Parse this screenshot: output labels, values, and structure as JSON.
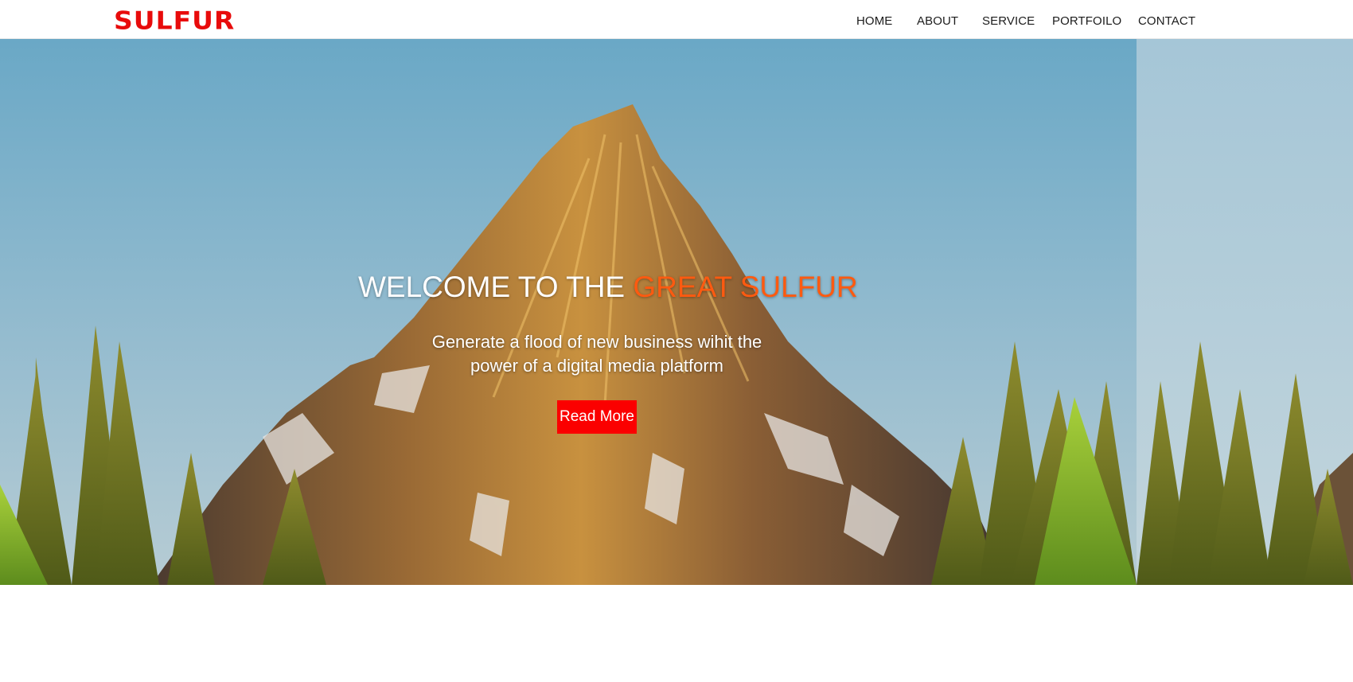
{
  "brand": {
    "logo_text": "SULFUR"
  },
  "nav": {
    "items": [
      {
        "label": "HOME"
      },
      {
        "label": "ABOUT"
      },
      {
        "label": "SERVICE"
      },
      {
        "label": "PORTFOILO"
      },
      {
        "label": "CONTACT"
      }
    ]
  },
  "hero": {
    "title_main": "WELCOME TO THE ",
    "title_accent": "GREAT SULFUR",
    "subtitle": "Generate a flood of new business wihit the power of a digital media platform",
    "cta_label": "Read More"
  },
  "colors": {
    "brand_red": "#e80b0b",
    "accent_orange": "#ff5a10",
    "button_red": "#fb0000",
    "sky_top": "#6aa8c6",
    "sky_bottom": "#a9c8d6"
  }
}
